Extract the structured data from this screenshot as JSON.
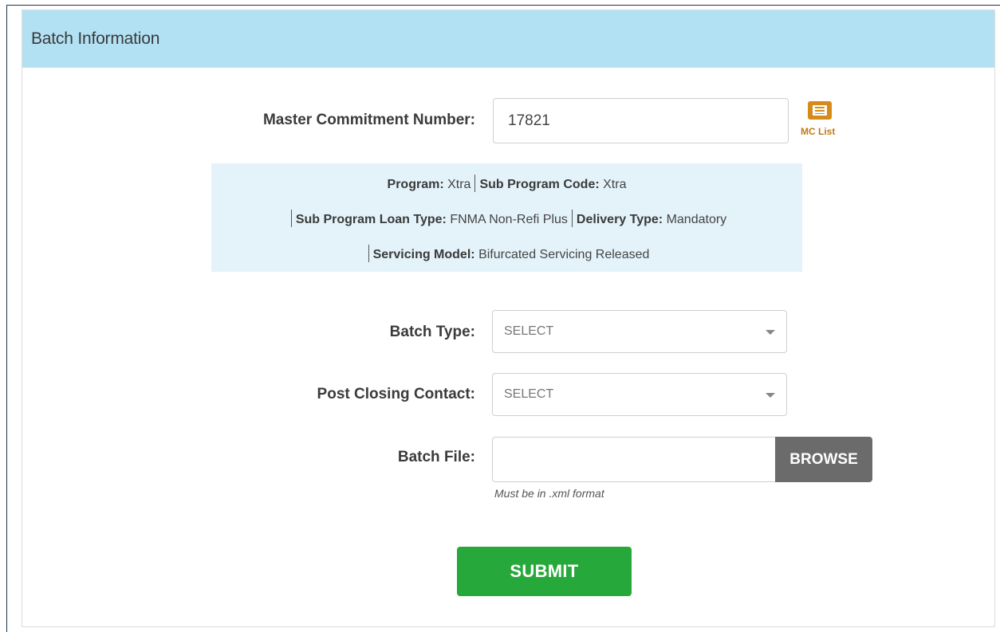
{
  "panel": {
    "title": "Batch Information"
  },
  "master_commitment": {
    "label": "Master Commitment Number:",
    "value": "17821",
    "mc_list_label": "MC List"
  },
  "program_info": {
    "program_label": "Program:",
    "program_value": "Xtra",
    "sub_program_code_label": "Sub Program Code:",
    "sub_program_code_value": "Xtra",
    "sub_program_loan_type_label": "Sub Program Loan Type:",
    "sub_program_loan_type_value": "FNMA Non-Refi Plus",
    "delivery_type_label": "Delivery Type:",
    "delivery_type_value": "Mandatory",
    "servicing_model_label": "Servicing Model:",
    "servicing_model_value": "Bifurcated Servicing Released"
  },
  "batch_type": {
    "label": "Batch Type:",
    "selected": "SELECT"
  },
  "post_closing_contact": {
    "label": "Post Closing Contact:",
    "selected": "SELECT"
  },
  "batch_file": {
    "label": "Batch File:",
    "value": "",
    "browse_label": "BROWSE",
    "hint": "Must be in .xml format"
  },
  "submit_label": "SUBMIT",
  "colors": {
    "header_bg": "#b3e1f4",
    "info_bg": "#e4f3fa",
    "submit_bg": "#27a83a",
    "browse_bg": "#6b6b6b",
    "mc_icon": "#d68a1a"
  },
  "icons": {
    "mc_list": "list-icon",
    "dropdown": "chevron-down-icon"
  }
}
